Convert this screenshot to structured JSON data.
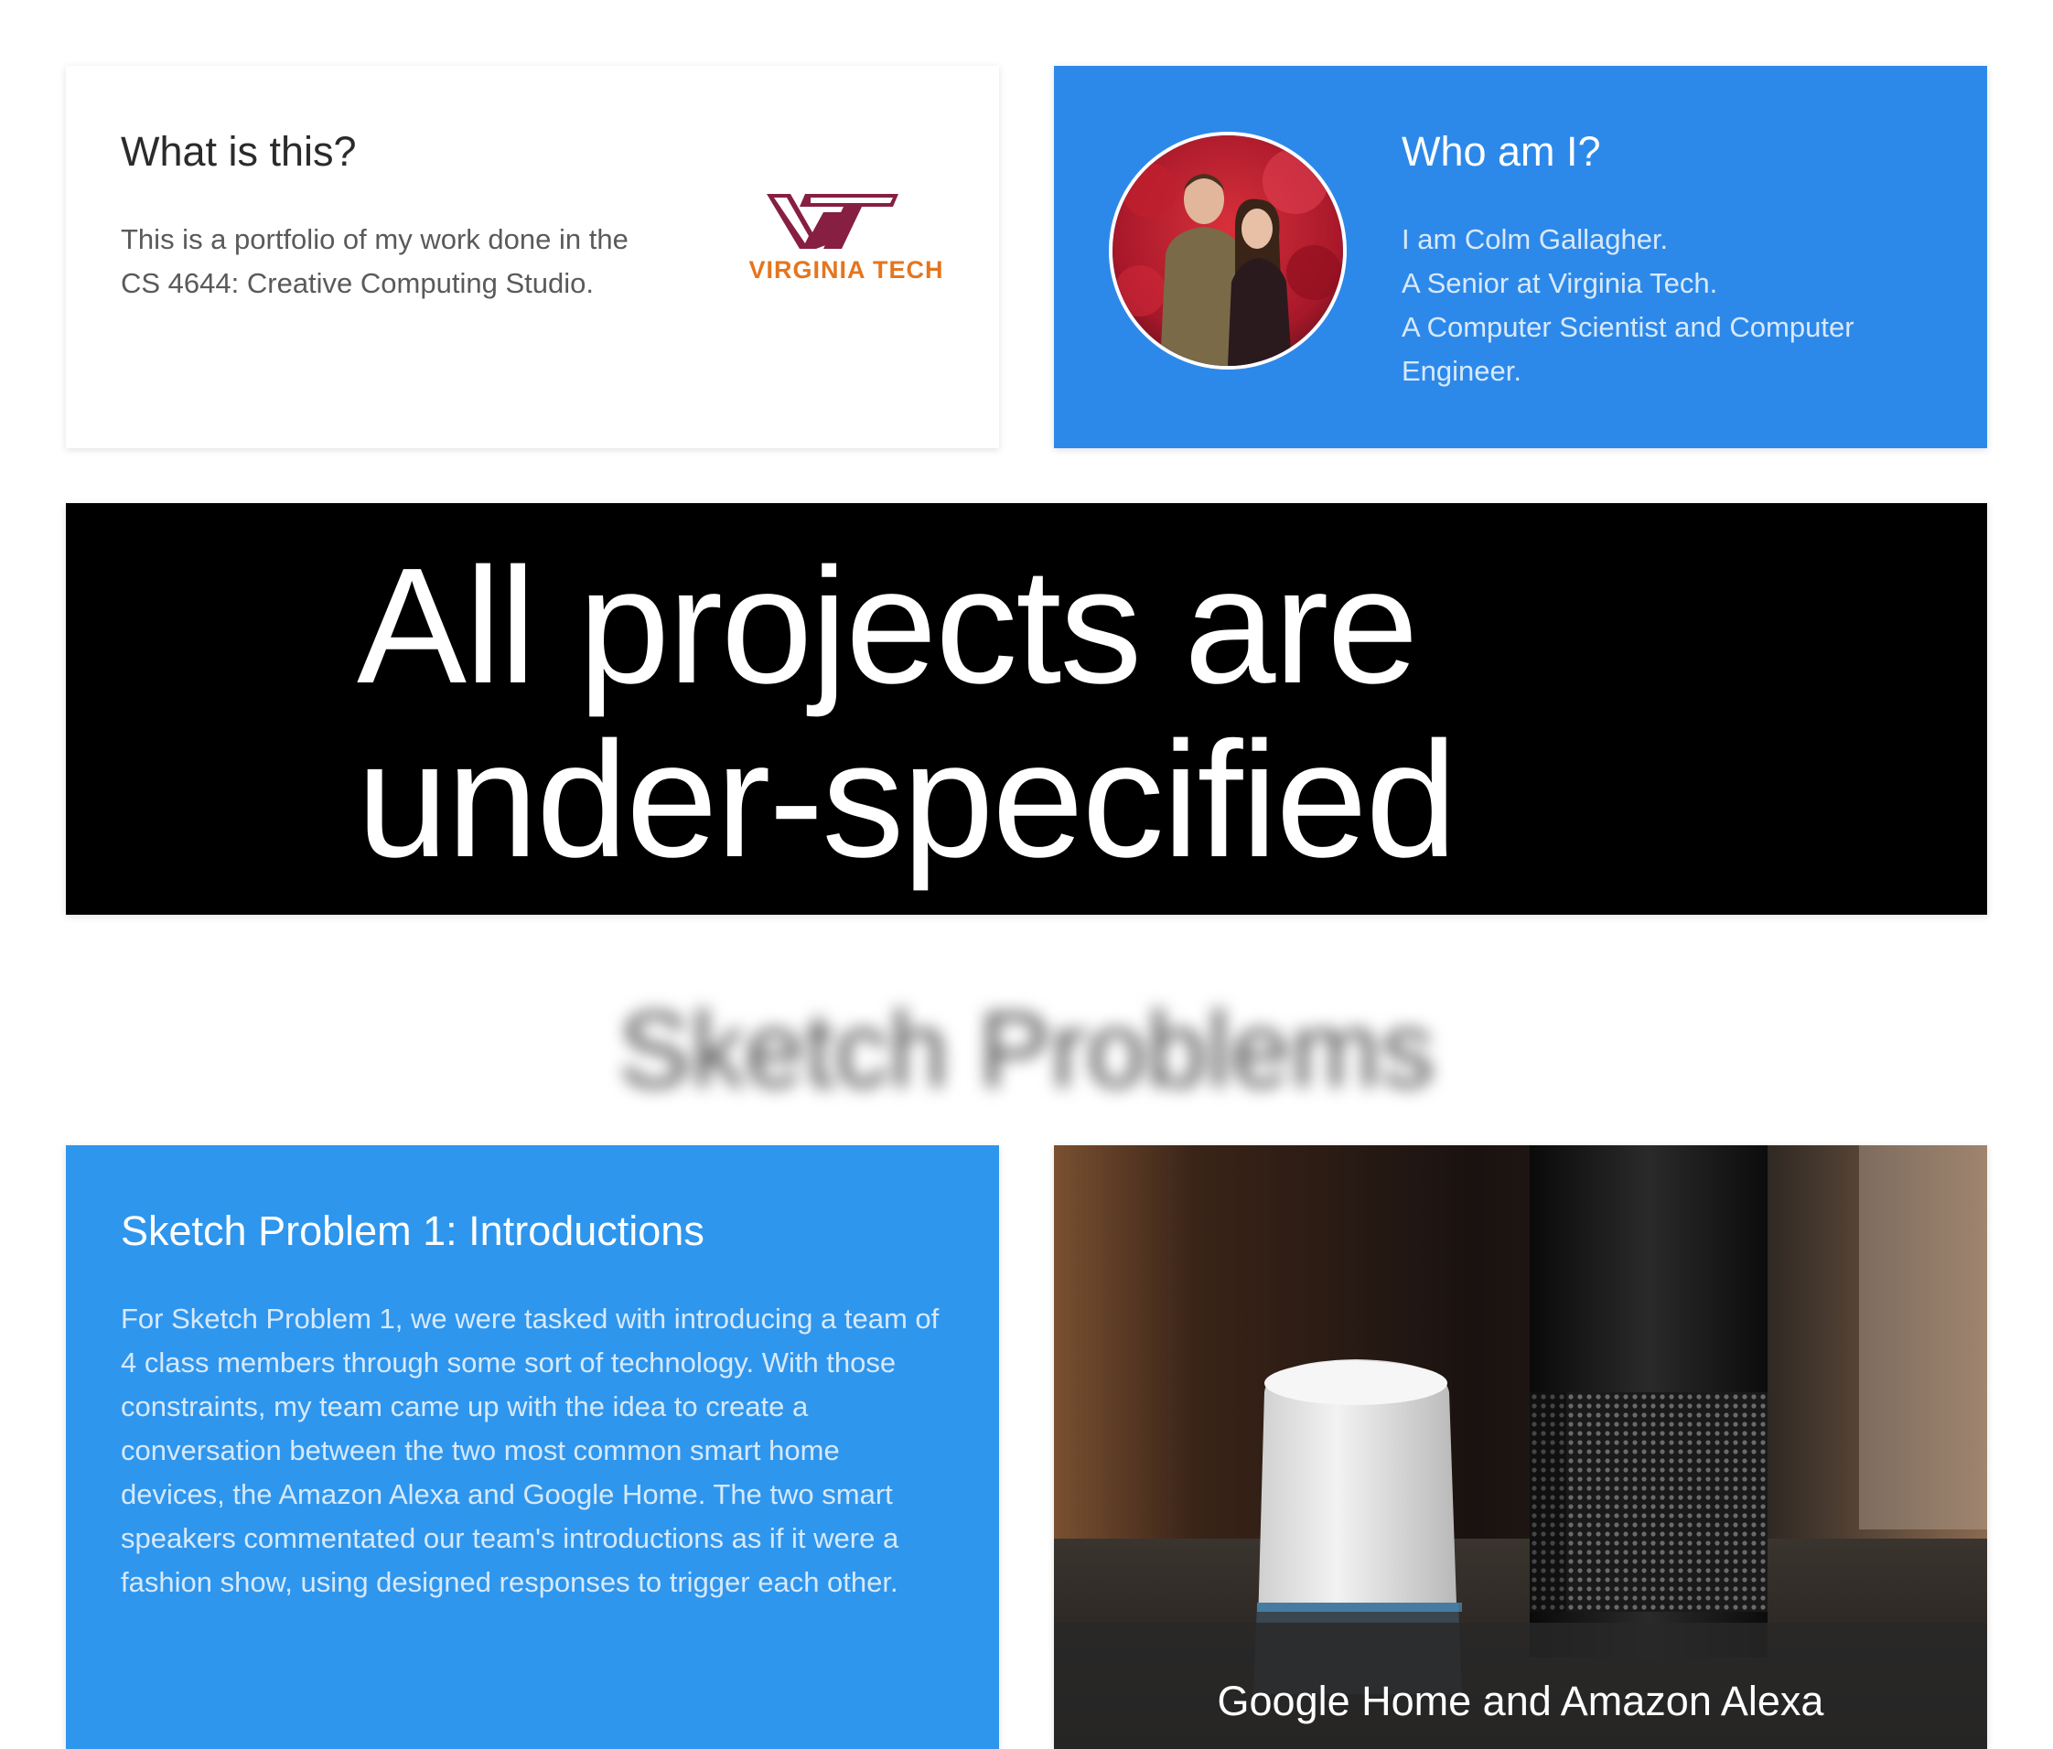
{
  "about": {
    "title": "What is this?",
    "text": "This is a portfolio of my work done in the CS 4644: Creative Computing Studio.",
    "logo_wordmark": "VIRGINIA TECH",
    "logo_monogram": "VT"
  },
  "who": {
    "title": "Who am I?",
    "lines": [
      "I am Colm Gallagher.",
      "A Senior at Virginia Tech.",
      "A Computer Scientist and Computer Engineer."
    ]
  },
  "banner": {
    "line1": "All projects are",
    "line2": "under-specified"
  },
  "section": {
    "heading": "Sketch Problems"
  },
  "sketch1": {
    "title": "Sketch Problem 1: Introductions",
    "text": "For Sketch Problem 1, we were tasked with introducing a team of 4 class members through some sort of technology. With those constraints, my team came up with the idea to create a conversation between the two most common smart home devices, the Amazon Alexa and Google Home. The two smart speakers commentated our team's introductions as if it were a fashion show, using designed responses to trigger each other.",
    "image_caption": "Google Home and Amazon Alexa"
  },
  "colors": {
    "who_card": "#2d89e9",
    "sketch_card": "#2f96ed",
    "banner": "#000000",
    "vt_maroon": "#861f41",
    "vt_orange": "#e5751f"
  }
}
